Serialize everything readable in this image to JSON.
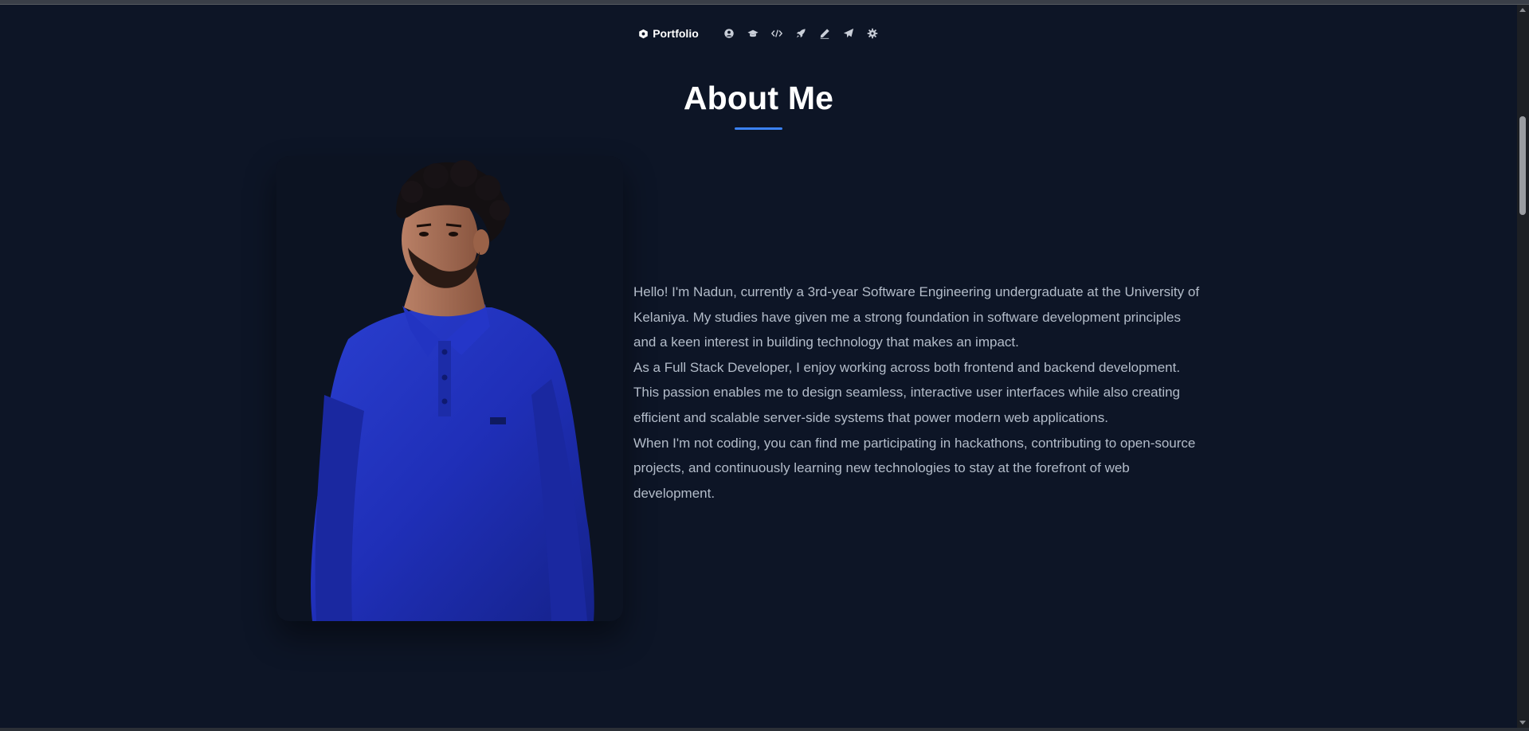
{
  "nav": {
    "brand_label": "Portfolio",
    "brand_icon": "hexagon-logo-icon",
    "items": [
      {
        "icon": "user-icon",
        "target": "about"
      },
      {
        "icon": "graduation-cap-icon",
        "target": "education"
      },
      {
        "icon": "code-icon",
        "target": "skills"
      },
      {
        "icon": "rocket-icon",
        "target": "projects"
      },
      {
        "icon": "pen-icon",
        "target": "blog"
      },
      {
        "icon": "paper-plane-icon",
        "target": "contact"
      },
      {
        "icon": "settings-icon",
        "target": "settings"
      }
    ]
  },
  "about": {
    "title": "About Me",
    "photo_icon": "profile-photo",
    "paragraphs": [
      "Hello! I'm Nadun, currently a 3rd-year Software Engineering undergraduate at the University of Kelaniya. My studies have given me a strong foundation in software development principles and a keen interest in building technology that makes an impact.",
      "As a Full Stack Developer, I enjoy working across both frontend and backend development. This passion enables me to design seamless, interactive user interfaces while also creating efficient and scalable server-side systems that power modern web applications.",
      "When I'm not coding, you can find me participating in hackathons, contributing to open-source projects, and continuously learning new technologies to stay at the forefront of web development."
    ]
  },
  "theme": {
    "background": "#0d1526",
    "accent": "#3b82f6",
    "text": "#b3bcc9",
    "heading": "#ffffff"
  }
}
